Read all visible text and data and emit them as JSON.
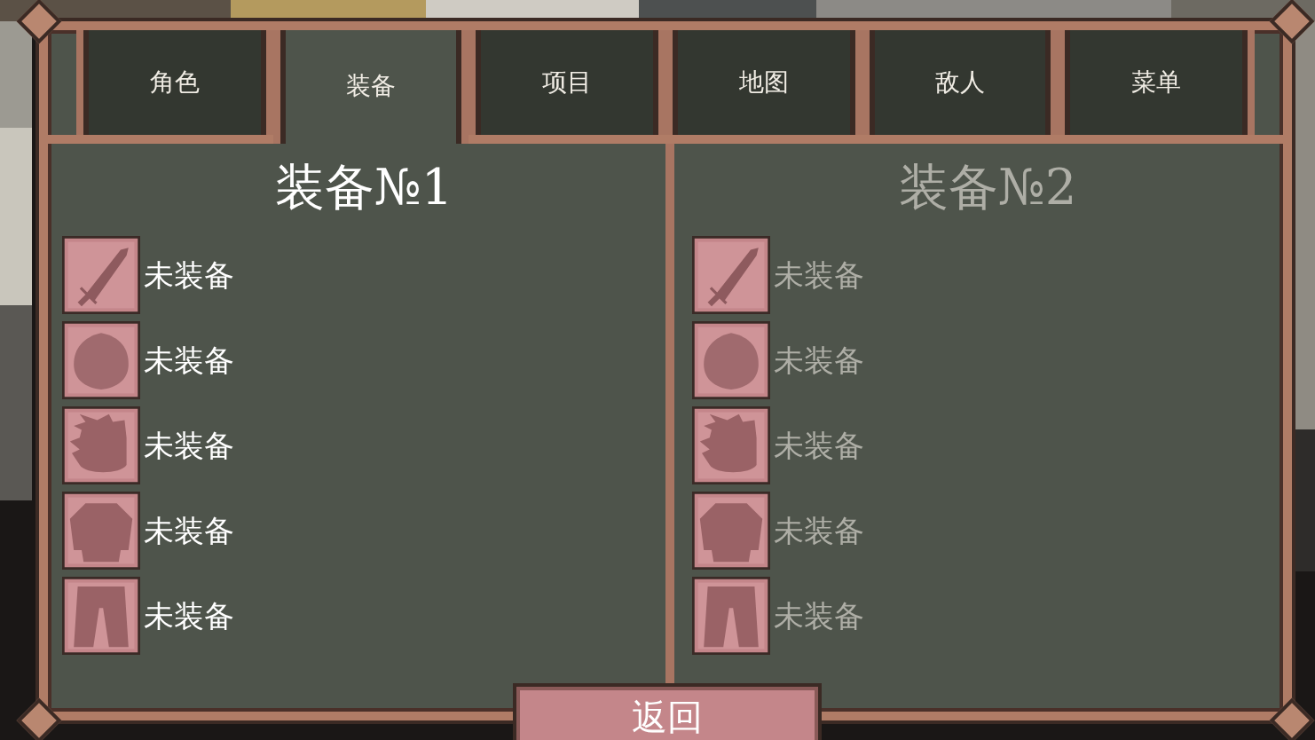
{
  "tabs": [
    {
      "label": "角色",
      "selected": false
    },
    {
      "label": "装备",
      "selected": true
    },
    {
      "label": "项目",
      "selected": false
    },
    {
      "label": "地图",
      "selected": false
    },
    {
      "label": "敌人",
      "selected": false
    },
    {
      "label": "菜单",
      "selected": false
    }
  ],
  "loadouts": [
    {
      "title": "装备№1",
      "active": true,
      "slots": [
        {
          "kind": "sword",
          "label": "未装备"
        },
        {
          "kind": "helmet",
          "label": "未装备"
        },
        {
          "kind": "hair",
          "label": "未装备"
        },
        {
          "kind": "armor",
          "label": "未装备"
        },
        {
          "kind": "pants",
          "label": "未装备"
        }
      ]
    },
    {
      "title": "装备№2",
      "active": false,
      "slots": [
        {
          "kind": "sword",
          "label": "未装备"
        },
        {
          "kind": "helmet",
          "label": "未装备"
        },
        {
          "kind": "hair",
          "label": "未装备"
        },
        {
          "kind": "armor",
          "label": "未装备"
        },
        {
          "kind": "pants",
          "label": "未装备"
        }
      ]
    }
  ],
  "back_button": "返回"
}
